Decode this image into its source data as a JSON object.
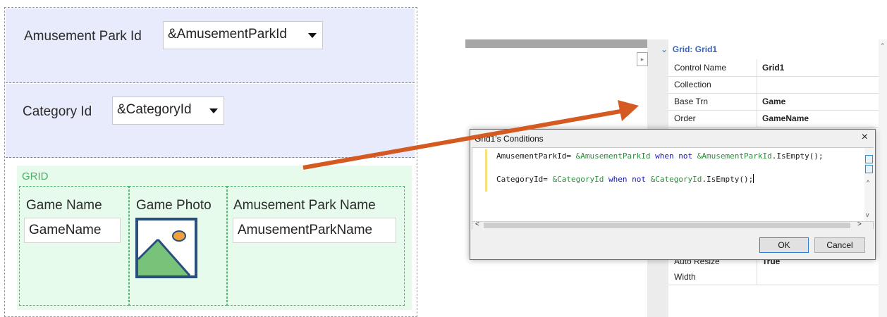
{
  "form": {
    "park_label": "Amusement Park Id",
    "park_combo": "&AmusementParkId",
    "category_label": "Category Id",
    "category_combo": "&CategoryId",
    "grid_title": "GRID",
    "columns": [
      {
        "header": "Game Name",
        "field": "GameName"
      },
      {
        "header": "Game Photo",
        "field": ""
      },
      {
        "header": "Amusement Park Name",
        "field": "AmusementParkName"
      }
    ]
  },
  "properties": {
    "group": "Grid: Grid1",
    "rows": [
      {
        "name": "Control Name",
        "value": "Grid1"
      },
      {
        "name": "Collection",
        "value": ""
      },
      {
        "name": "Base Trn",
        "value": "Game"
      },
      {
        "name": "Order",
        "value": "GameName"
      }
    ],
    "lower_rows": [
      {
        "name": "Auto Resize",
        "value": "True"
      },
      {
        "name": "Width",
        "value": ""
      }
    ]
  },
  "dialog": {
    "title": "Grid1's Conditions",
    "close": "×",
    "line1": {
      "a": "AmusementParkId= ",
      "b": "&AmusementParkId",
      "c": " when not ",
      "d": "&AmusementParkId",
      "e": ".IsEmpty();"
    },
    "line2": {
      "a": "CategoryId= ",
      "b": "&CategoryId",
      "c": " when not ",
      "d": "&CategoryId",
      "e": ".IsEmpty();"
    },
    "ok": "OK",
    "cancel": "Cancel"
  },
  "colors": {
    "form_row_bg": "#e8ebfb",
    "grid_bg": "#e6fbeb",
    "arrow": "#d45a22",
    "variable": "#2e8a3b",
    "keyword": "#1616b5"
  }
}
